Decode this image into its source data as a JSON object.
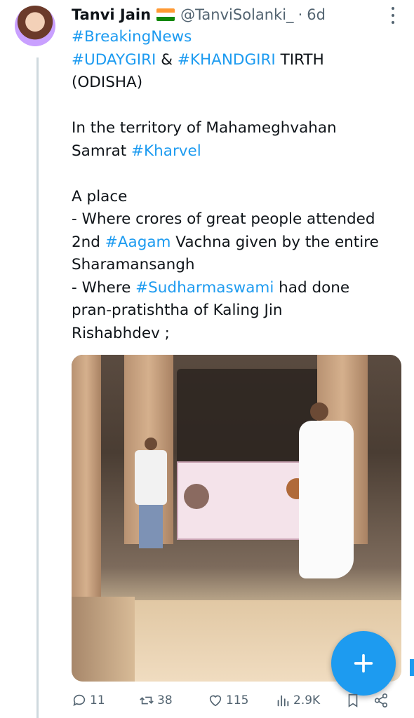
{
  "tweet": {
    "name": "Tanvi Jain",
    "handle": "@TanviSolanki_",
    "separator": "·",
    "time": "6d",
    "line1_tag": "#BreakingNews",
    "line2_tag1": "#UDAYGIRI",
    "line2_amp": " & ",
    "line2_tag2": "#KHANDGIRI",
    "line2_rest": " TIRTH",
    "line3": "(ODISHA)",
    "line4": "In the territory of Mahameghvahan",
    "line5_text": "Samrat ",
    "line5_tag": "#Kharvel",
    "line6": "A place",
    "line7": "- Where crores of great people attended",
    "line8_pre": "2nd ",
    "line8_tag": "#Aagam",
    "line8_post": " Vachna given by the entire",
    "line9": "Sharamansangh",
    "line10_pre": "- Where ",
    "line10_tag": "#Sudharmaswami",
    "line10_post": " had done",
    "line11": "pran-pratishtha of Kaling Jin",
    "line12": "Rishabhdev ;"
  },
  "actions": {
    "replies": "11",
    "retweets": "38",
    "likes": "115",
    "views": "2.9K"
  },
  "colors": {
    "accent": "#1d9bf0",
    "muted": "#536471",
    "text": "#0f1419"
  },
  "icons": [
    "more-icon",
    "reply-icon",
    "retweet-icon",
    "like-icon",
    "views-icon",
    "bookmark-icon",
    "share-icon",
    "plus-icon"
  ]
}
